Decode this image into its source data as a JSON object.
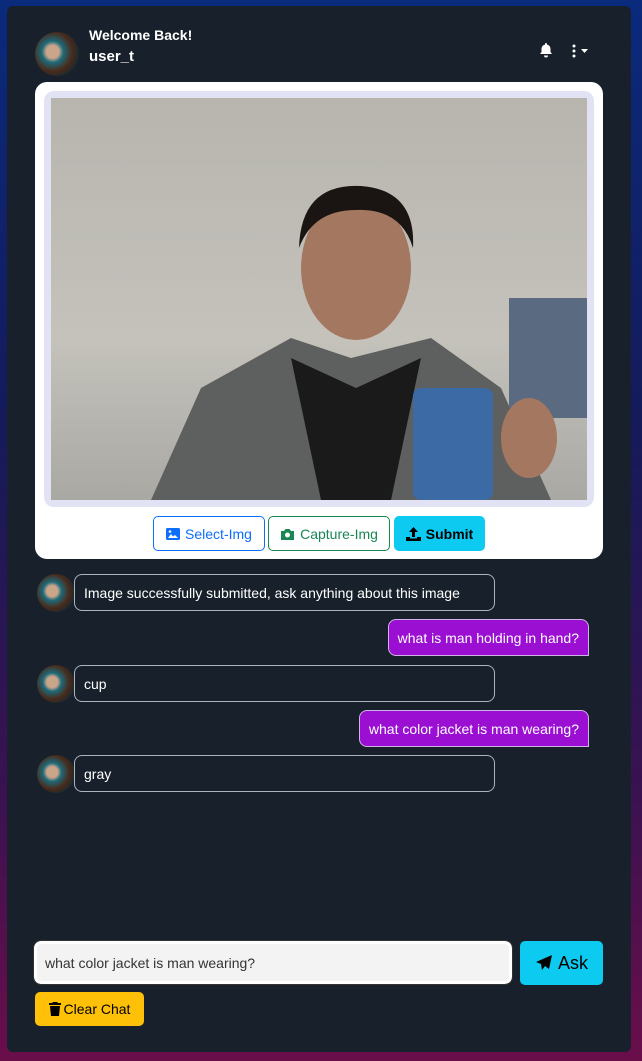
{
  "header": {
    "welcome": "Welcome Back!",
    "username": "user_t"
  },
  "buttons": {
    "select": "Select-Img",
    "capture": "Capture-Img",
    "submit": "Submit",
    "ask": "Ask",
    "clear": "Clear Chat"
  },
  "messages": [
    {
      "role": "bot",
      "text": "Image successfully submitted, ask anything about this image"
    },
    {
      "role": "user",
      "text": "what is man holding in hand?"
    },
    {
      "role": "bot",
      "text": "cup"
    },
    {
      "role": "user",
      "text": "what color jacket is man wearing?"
    },
    {
      "role": "bot",
      "text": "gray"
    }
  ],
  "input": {
    "value": "what color jacket is man wearing?"
  },
  "colors": {
    "accent": "#0dcaf0",
    "user_bubble": "#9a0fd1",
    "clear": "#ffc107"
  }
}
